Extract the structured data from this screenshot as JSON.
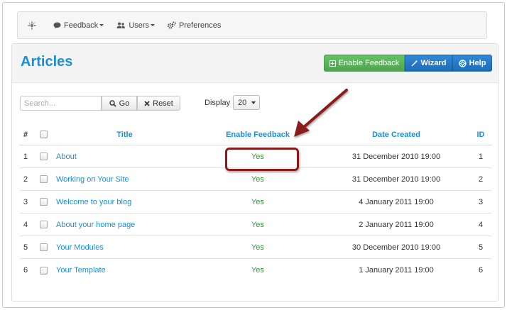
{
  "nav": {
    "items": [
      {
        "label": "Feedback",
        "icon": "comment-icon"
      },
      {
        "label": "Users",
        "icon": "users-icon"
      },
      {
        "label": "Preferences",
        "icon": "cogs-icon"
      }
    ]
  },
  "page": {
    "title": "Articles"
  },
  "actions": {
    "enable_feedback": "Enable Feedback",
    "wizard": "Wizard",
    "help": "Help"
  },
  "toolbar": {
    "search_placeholder": "Search...",
    "go_label": "Go",
    "reset_label": "Reset",
    "display_label": "Display",
    "display_value": "20"
  },
  "table": {
    "headers": {
      "num": "#",
      "title": "Title",
      "enable_feedback": "Enable Feedback",
      "date_created": "Date Created",
      "id": "ID"
    },
    "rows": [
      {
        "num": "1",
        "title": "About",
        "feedback": "Yes",
        "date": "31 December 2010 19:00",
        "id": "1"
      },
      {
        "num": "2",
        "title": "Working on Your Site",
        "feedback": "Yes",
        "date": "31 December 2010 19:00",
        "id": "2"
      },
      {
        "num": "3",
        "title": "Welcome to your blog",
        "feedback": "Yes",
        "date": "4 January 2011 19:00",
        "id": "3"
      },
      {
        "num": "4",
        "title": "About your home page",
        "feedback": "Yes",
        "date": "2 January 2011 19:00",
        "id": "4"
      },
      {
        "num": "5",
        "title": "Your Modules",
        "feedback": "Yes",
        "date": "30 December 2010 19:00",
        "id": "5"
      },
      {
        "num": "6",
        "title": "Your Template",
        "feedback": "Yes",
        "date": "1 January 2011 19:00",
        "id": "6"
      }
    ]
  },
  "colors": {
    "accent": "#1a8fd6",
    "success": "#2ba02b",
    "annotation": "#8b1b1b"
  }
}
